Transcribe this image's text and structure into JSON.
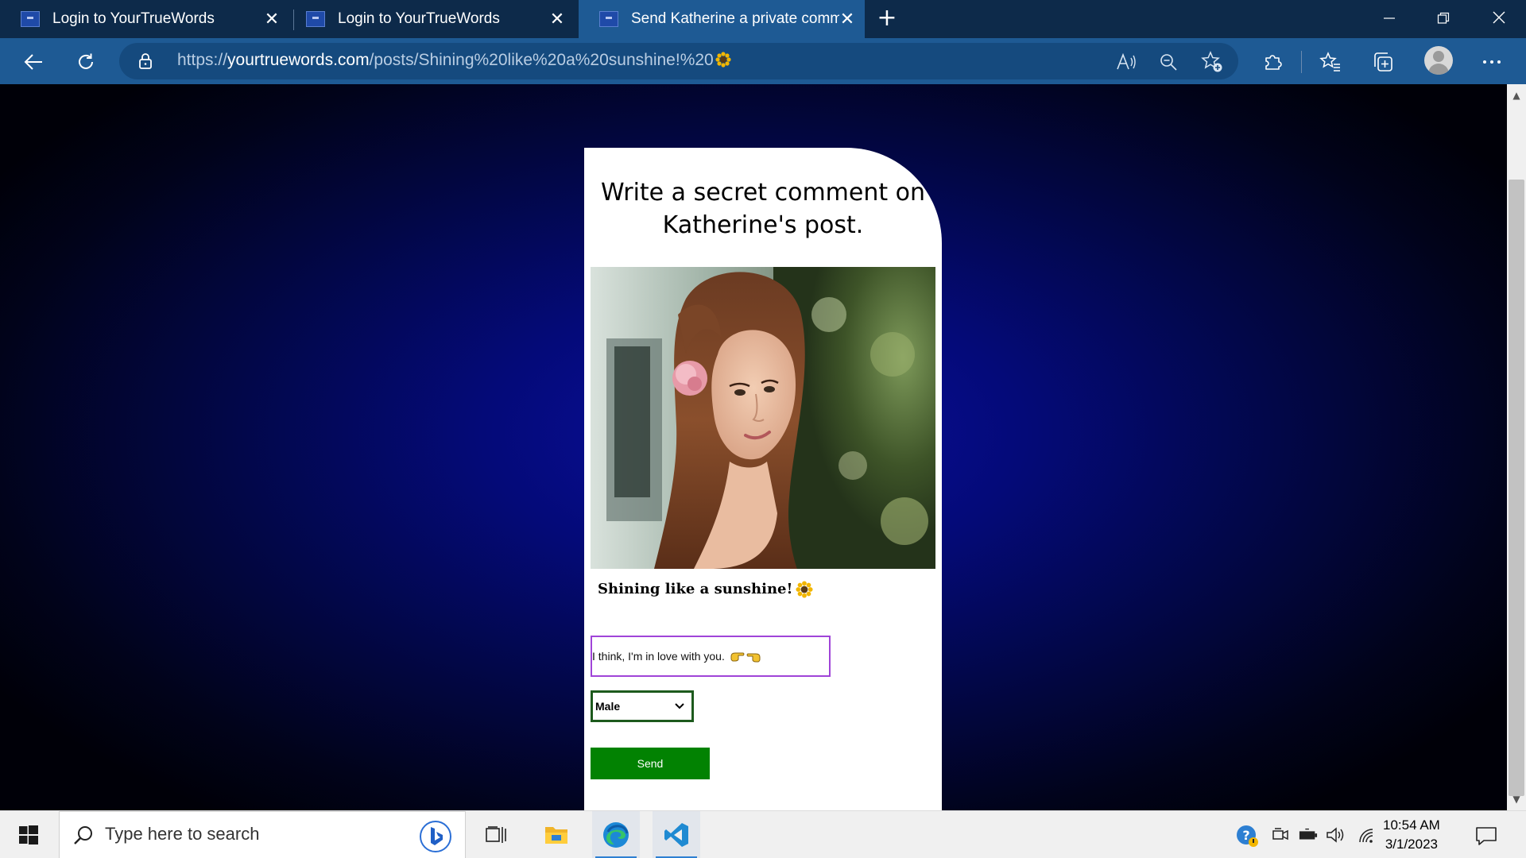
{
  "browser": {
    "tabs": [
      {
        "title": "Login to YourTrueWords",
        "active": false
      },
      {
        "title": "Login to YourTrueWords",
        "active": false
      },
      {
        "title": "Send Katherine a private comme",
        "active": true
      }
    ],
    "url": {
      "scheme": "https://",
      "host": "yourtruewords.com",
      "path": "/posts/Shining%20like%20a%20sunshine!%20",
      "trailing_icon": "sunflower-emoji"
    },
    "icons": [
      "back-icon",
      "refresh-icon",
      "lock-icon",
      "read-aloud-icon",
      "zoom-out-icon",
      "add-favorite-icon",
      "extensions-icon",
      "favorites-icon",
      "collections-icon",
      "profile-avatar",
      "more-icon"
    ]
  },
  "page": {
    "title": "Write a secret comment on Katherine's post.",
    "post_caption": "Shining like a sunshine!",
    "comment_value": "I think, I'm in love with you.",
    "comment_emoji": [
      "hand-pointing-right",
      "hand-pointing-left"
    ],
    "gender_selected": "Male",
    "send_label": "Send",
    "colors": {
      "send_button": "#028202",
      "comment_border": "#a044d8",
      "select_border": "#1d5a1d"
    }
  },
  "taskbar": {
    "search_placeholder": "Type here to search",
    "time": "10:54 AM",
    "date": "3/1/2023",
    "apps": [
      "task-view-icon",
      "file-explorer-icon",
      "edge-icon",
      "vscode-icon"
    ]
  }
}
